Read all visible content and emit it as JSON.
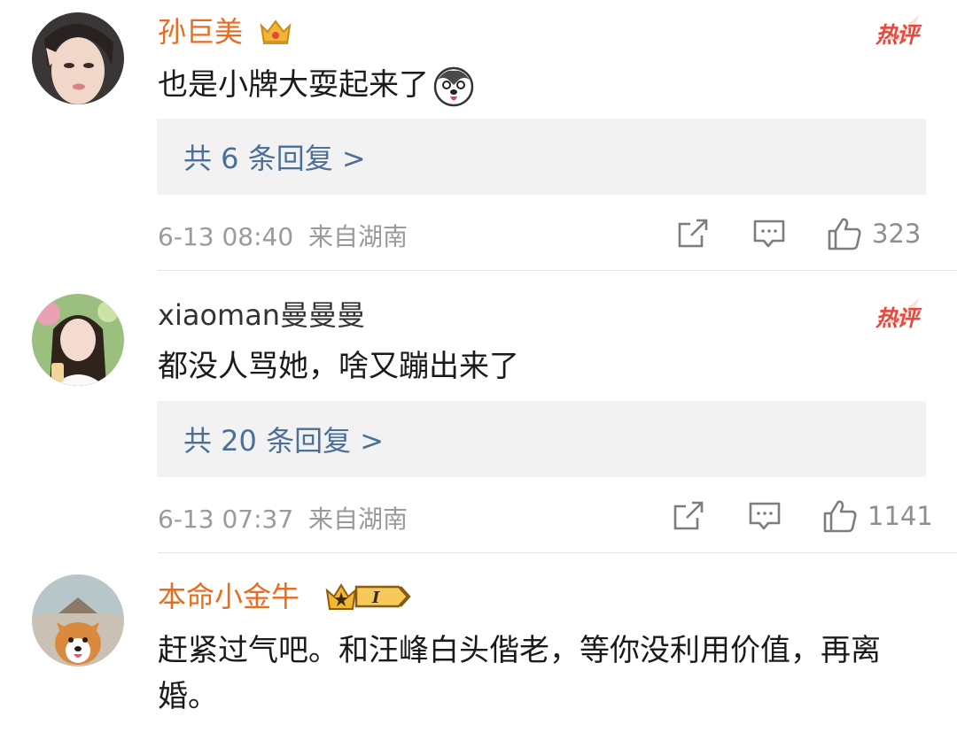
{
  "comments": [
    {
      "username": "孙巨美",
      "text": "也是小牌大耍起来了",
      "replies": "共 6 条回复 >",
      "time": "6-13 08:40",
      "source": "来自湖南",
      "likes": "323",
      "hot_label": "热评"
    },
    {
      "username": "xiaoman曼曼曼",
      "text": "都没人骂她，啥又蹦出来了",
      "replies": "共 20 条回复 >",
      "time": "6-13 07:37",
      "source": "来自湖南",
      "likes": "1141",
      "hot_label": "热评"
    },
    {
      "username": "本命小金牛",
      "text": "赶紧过气吧。和汪峰白头偕老，等你没利用价值，再离婚。",
      "badge_level": "I"
    }
  ],
  "colors": {
    "vip_name": "#e86c1d",
    "normal_name": "#333333",
    "reply_link": "#4b6f96",
    "hot_badge": "#e8473c"
  },
  "icons": [
    "crown-icon",
    "dog-emoji-icon",
    "share-icon",
    "comment-icon",
    "like-icon",
    "vip-level-badge-icon"
  ]
}
